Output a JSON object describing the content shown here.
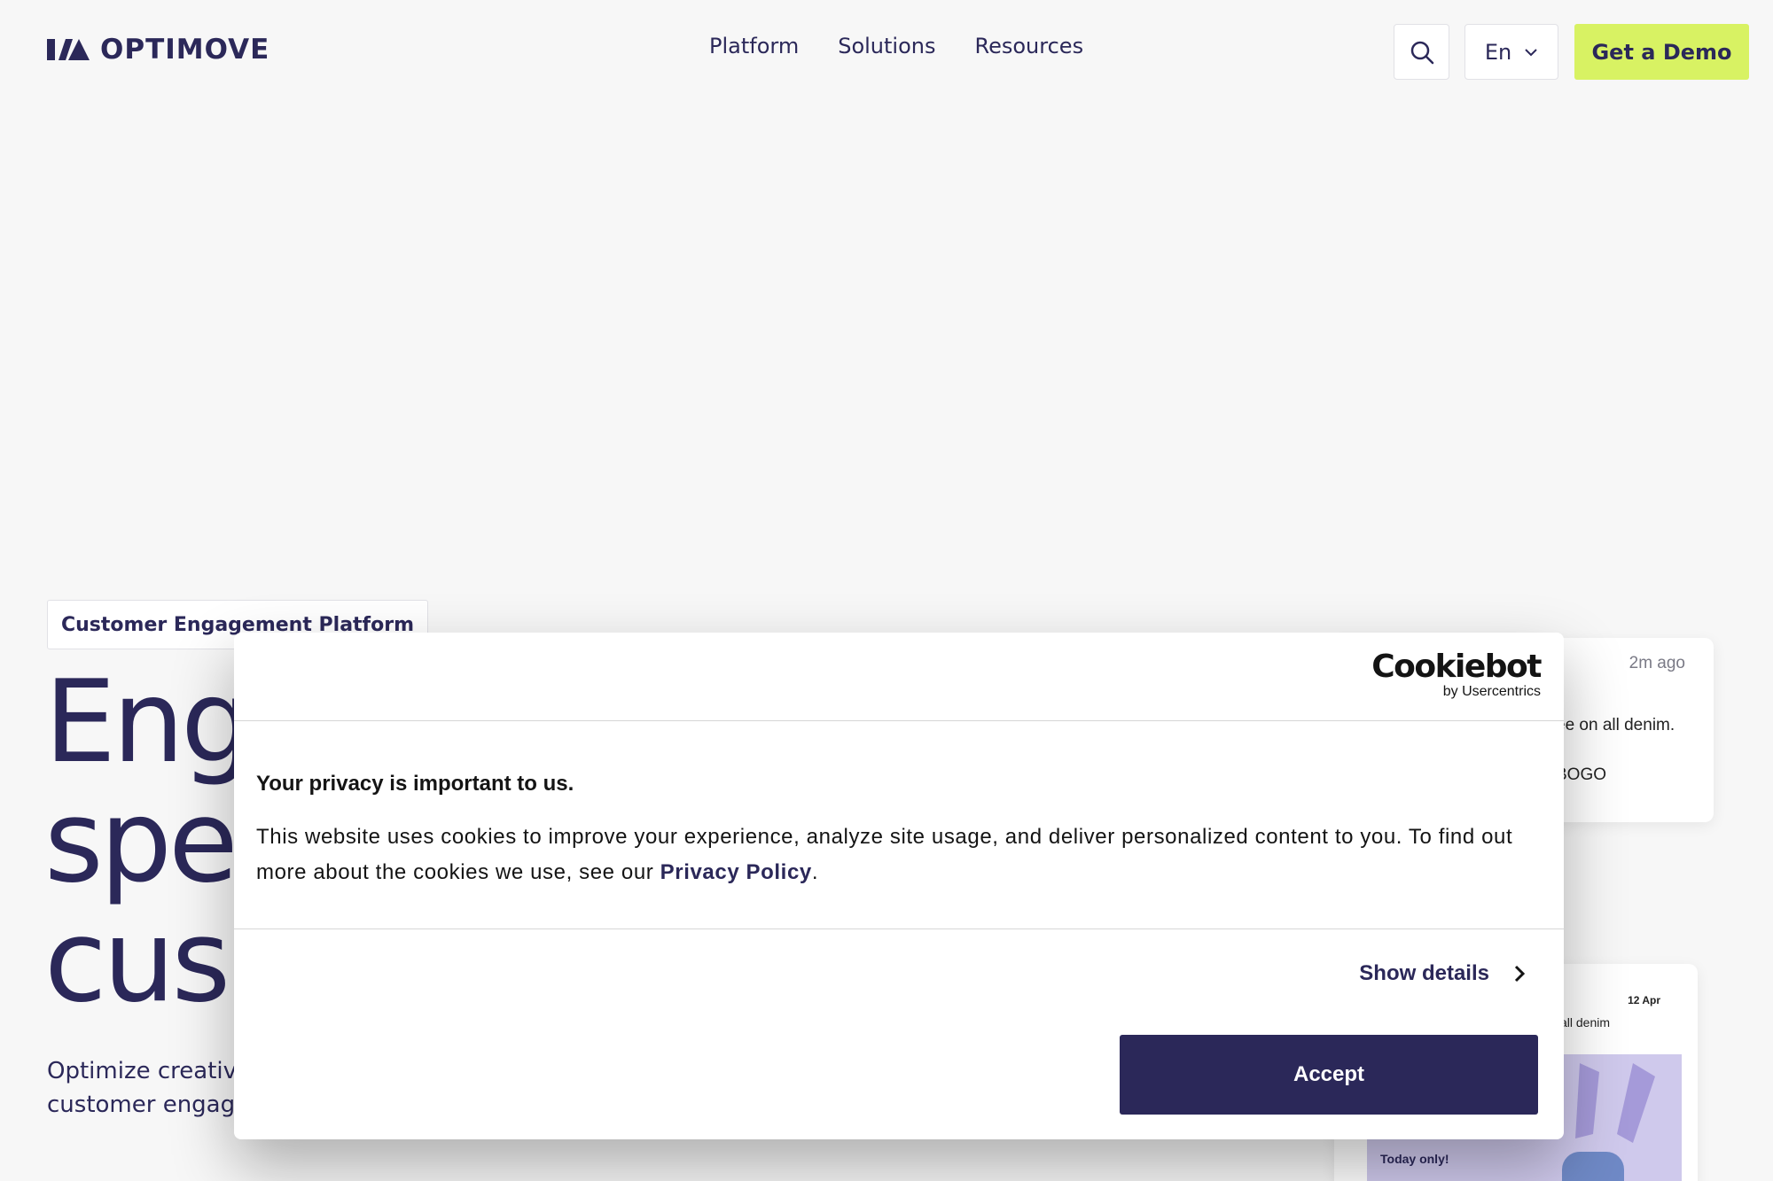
{
  "header": {
    "logo_text": "OPTIMOVE",
    "nav": [
      "Platform",
      "Solutions",
      "Resources"
    ],
    "language": "En",
    "demo_label": "Get a Demo"
  },
  "hero": {
    "badge": "Customer Engagement Platform",
    "title_lines": [
      "Eng",
      "spe",
      "cus"
    ],
    "sub_lines": [
      "Optimize creativ",
      "customer engag"
    ]
  },
  "cards": {
    "notif_time": "2m ago",
    "notif_line1": "ee on all denim.",
    "notif_line2": "BOGO",
    "promo_date": "12 Apr",
    "promo_text": "all denim",
    "promo_today": "Today only!"
  },
  "cookie": {
    "brand": "Cookiebot",
    "brand_by": "by Usercentrics",
    "heading": "Your privacy is important to us.",
    "text": "This website uses cookies to improve your experience, analyze site usage, and deliver personalized content to you. To find out more about the cookies we use, see our",
    "policy_link": "Privacy Policy",
    "text_end": ".",
    "show_details": "Show details",
    "accept": "Accept"
  },
  "colors": {
    "brand": "#2b2859",
    "accent": "#d8f263",
    "background": "#f7f7f7"
  }
}
